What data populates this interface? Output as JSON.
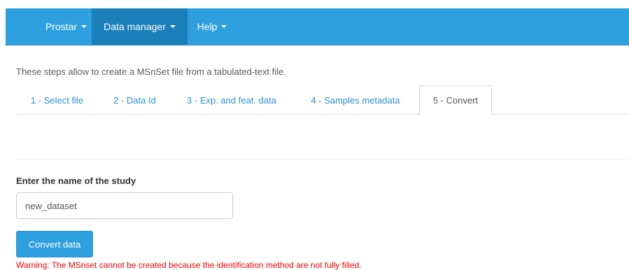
{
  "navbar": {
    "items": [
      {
        "label": "Prostar",
        "active": false
      },
      {
        "label": "Data manager",
        "active": true
      },
      {
        "label": "Help",
        "active": false
      }
    ]
  },
  "main": {
    "intro": "These steps allow to create a MSnSet file from a tabulated-text file.",
    "tabs": [
      {
        "label": "1 - Select file"
      },
      {
        "label": "2 - Data Id"
      },
      {
        "label": "3 - Exp. and feat. data"
      },
      {
        "label": "4 - Samples metadata"
      },
      {
        "label": "5 - Convert",
        "active": true
      }
    ],
    "study_label": "Enter the name of the study",
    "study_input_value": "new_dataset",
    "convert_button": "Convert data",
    "warning": "Warning: The MSnset cannot be created because the identification method are not fully filled."
  },
  "colors": {
    "navbar": "#2ea0e0",
    "navbar_active": "#1b7fb9",
    "link": "#2a8fd6",
    "warning": "#ff0000"
  }
}
